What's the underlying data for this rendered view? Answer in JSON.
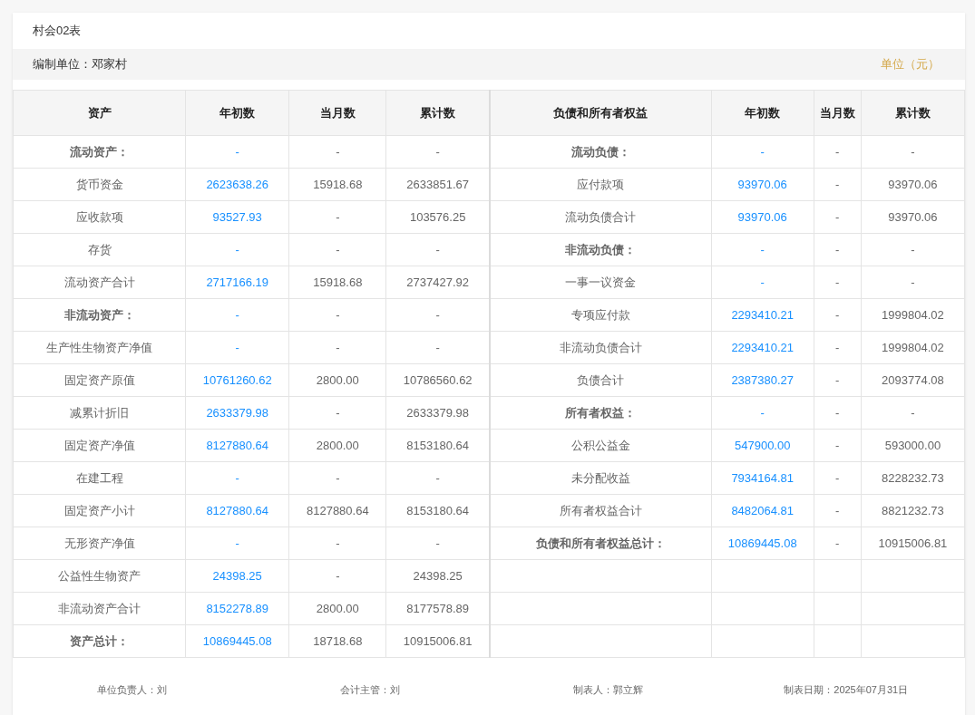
{
  "form_code": "村会02表",
  "unit_bar": {
    "compiler": "编制单位：邓家村",
    "currency": "单位（元）"
  },
  "columns_left": [
    "资产",
    "年初数",
    "当月数",
    "累计数"
  ],
  "columns_right": [
    "负债和所有者权益",
    "年初数",
    "当月数",
    "累计数"
  ],
  "rows": [
    {
      "left": {
        "kind": "heading",
        "label": "流动资产：",
        "start": "-",
        "month": "-",
        "total": "-"
      },
      "right": {
        "kind": "heading",
        "label": "流动负债：",
        "start": "-",
        "month": "-",
        "total": "-"
      }
    },
    {
      "left": {
        "kind": "line",
        "label": "货币资金",
        "start": "2623638.26",
        "month": "15918.68",
        "total": "2633851.67"
      },
      "right": {
        "kind": "line",
        "label": "应付款项",
        "start": "93970.06",
        "month": "-",
        "total": "93970.06"
      }
    },
    {
      "left": {
        "kind": "line",
        "label": "应收款项",
        "start": "93527.93",
        "month": "-",
        "total": "103576.25"
      },
      "right": {
        "kind": "line",
        "label": "流动负债合计",
        "start": "93970.06",
        "month": "-",
        "total": "93970.06"
      }
    },
    {
      "left": {
        "kind": "line",
        "label": "存货",
        "start": "-",
        "month": "-",
        "total": "-"
      },
      "right": {
        "kind": "heading",
        "label": "非流动负债：",
        "start": "-",
        "month": "-",
        "total": "-"
      }
    },
    {
      "left": {
        "kind": "line",
        "label": "流动资产合计",
        "start": "2717166.19",
        "month": "15918.68",
        "total": "2737427.92"
      },
      "right": {
        "kind": "line",
        "label": "一事一议资金",
        "start": "-",
        "month": "-",
        "total": "-"
      }
    },
    {
      "left": {
        "kind": "heading",
        "label": "非流动资产：",
        "start": "-",
        "month": "-",
        "total": "-"
      },
      "right": {
        "kind": "line",
        "label": "专项应付款",
        "start": "2293410.21",
        "month": "-",
        "total": "1999804.02"
      }
    },
    {
      "left": {
        "kind": "line",
        "label": "生产性生物资产净值",
        "start": "-",
        "month": "-",
        "total": "-"
      },
      "right": {
        "kind": "line",
        "label": "非流动负债合计",
        "start": "2293410.21",
        "month": "-",
        "total": "1999804.02"
      }
    },
    {
      "left": {
        "kind": "line",
        "label": "固定资产原值",
        "start": "10761260.62",
        "month": "2800.00",
        "total": "10786560.62"
      },
      "right": {
        "kind": "line",
        "label": "负债合计",
        "start": "2387380.27",
        "month": "-",
        "total": "2093774.08"
      }
    },
    {
      "left": {
        "kind": "line",
        "label": "减累计折旧",
        "start": "2633379.98",
        "month": "-",
        "total": "2633379.98"
      },
      "right": {
        "kind": "heading",
        "label": "所有者权益：",
        "start": "-",
        "month": "-",
        "total": "-"
      }
    },
    {
      "left": {
        "kind": "line",
        "label": "固定资产净值",
        "start": "8127880.64",
        "month": "2800.00",
        "total": "8153180.64"
      },
      "right": {
        "kind": "line",
        "label": "公积公益金",
        "start": "547900.00",
        "month": "-",
        "total": "593000.00"
      }
    },
    {
      "left": {
        "kind": "line",
        "label": "在建工程",
        "start": "-",
        "month": "-",
        "total": "-"
      },
      "right": {
        "kind": "line",
        "label": "未分配收益",
        "start": "7934164.81",
        "month": "-",
        "total": "8228232.73"
      }
    },
    {
      "left": {
        "kind": "line",
        "label": "固定资产小计",
        "start": "8127880.64",
        "month": "8127880.64",
        "total": "8153180.64"
      },
      "right": {
        "kind": "line",
        "label": "所有者权益合计",
        "start": "8482064.81",
        "month": "-",
        "total": "8821232.73"
      }
    },
    {
      "left": {
        "kind": "line",
        "label": "无形资产净值",
        "start": "-",
        "month": "-",
        "total": "-"
      },
      "right": {
        "kind": "heading",
        "label": "负债和所有者权益总计：",
        "start": "10869445.08",
        "month": "-",
        "total": "10915006.81"
      }
    },
    {
      "left": {
        "kind": "line",
        "label": "公益性生物资产",
        "start": "24398.25",
        "month": "-",
        "total": "24398.25"
      },
      "right": null
    },
    {
      "left": {
        "kind": "line",
        "label": "非流动资产合计",
        "start": "8152278.89",
        "month": "2800.00",
        "total": "8177578.89"
      },
      "right": null
    },
    {
      "left": {
        "kind": "heading",
        "label": "资产总计：",
        "start": "10869445.08",
        "month": "18718.68",
        "total": "10915006.81"
      },
      "right": null
    }
  ],
  "signatures": [
    "单位负责人：刘",
    "会计主管：刘",
    "制表人：郭立辉",
    "制表日期：2025年07月31日"
  ]
}
